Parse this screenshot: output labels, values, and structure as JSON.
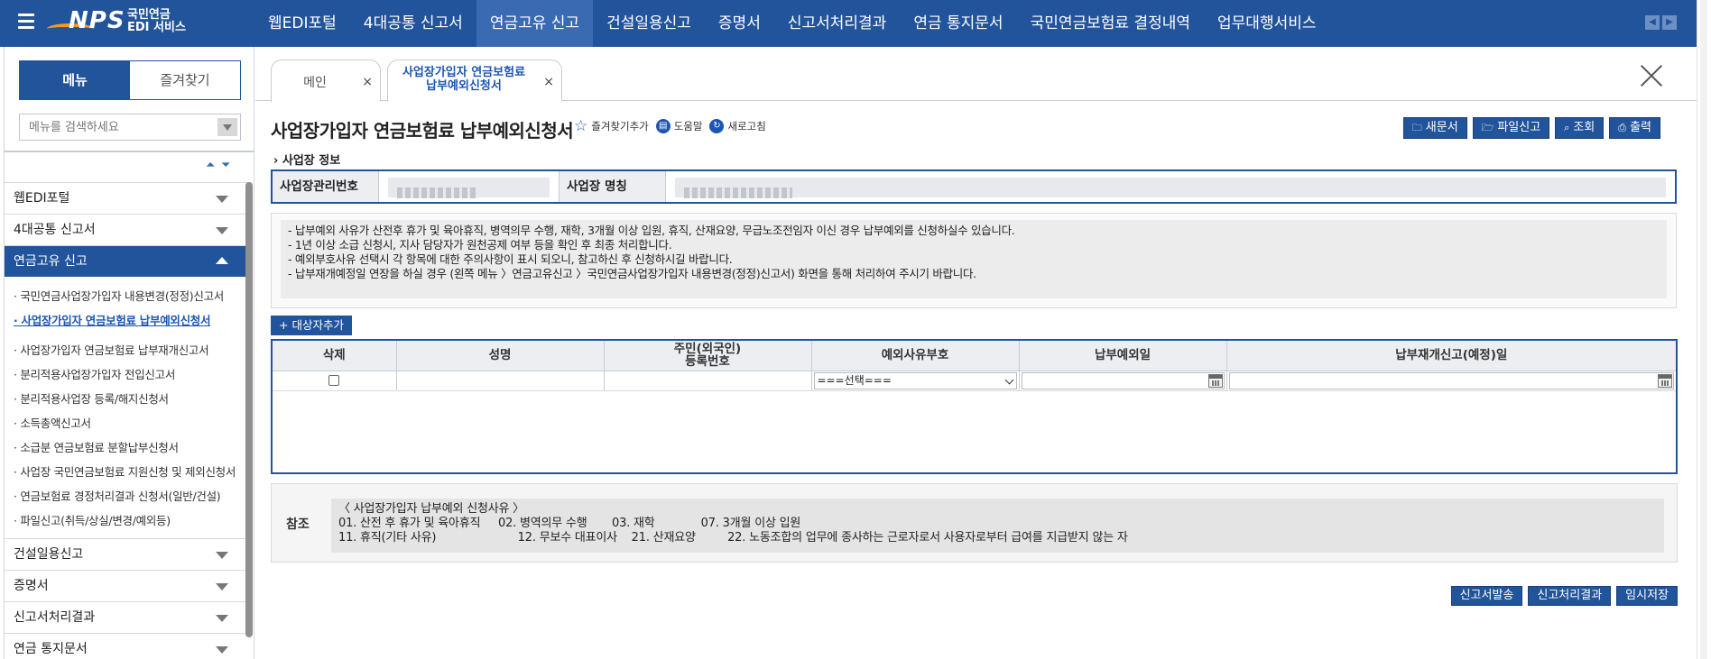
{
  "topbar": {
    "logo_main": "NPS",
    "logo_sub_1": "국민연금",
    "logo_sub_2": "EDI 서비스",
    "nav": [
      "웹EDI포털",
      "4대공통 신고서",
      "연금고유 신고",
      "건설일용신고",
      "증명서",
      "신고서처리결과",
      "연금 통지문서",
      "국민연금보험료 결정내역",
      "업무대행서비스"
    ],
    "active_nav_index": 2,
    "prev_icon": "chevron-left-icon",
    "next_icon": "chevron-right-icon",
    "accent_color": "#22549c"
  },
  "sidebar": {
    "tab_menu": "메뉴",
    "tab_favorites": "즐겨찾기",
    "search_placeholder": "메뉴를 검색하세요",
    "groups": {
      "g1": "웹EDI포털",
      "g2": "4대공통 신고서",
      "g3": "연금고유 신고",
      "g4": "건설일용신고",
      "g5": "증명서",
      "g6": "신고서처리결과",
      "g7": "연금 통지문서"
    },
    "sub_items": [
      "· 국민연금사업장가입자 내용변경(정정)신고서",
      "· 사업장가입자 연금보험료 납부예외신청서",
      "· 사업장가입자 연금보험료 납부재개신고서",
      "· 분리적용사업장가입자 전입신고서",
      "· 분리적용사업장 등록/해지신청서",
      "· 소득총액신고서",
      "· 소급분 연금보험료 분할납부신청서",
      "· 사업장 국민연금보험료 지원신청 및 제외신청서",
      "· 연금보험료 경정처리결과 신청서(일반/건설)",
      "· 파일신고(취득/상실/변경/예외등)"
    ],
    "selected_sub_index": 1
  },
  "tabs": {
    "main": "메인",
    "active_line1": "사업장가입자 연금보험료",
    "active_line2": "납부예외신청서",
    "close_symbol": "×"
  },
  "page": {
    "title": "사업장가입자 연금보험료 납부예외신청서",
    "tool_favorite": "즐겨찾기추가",
    "tool_help": "도움말",
    "tool_refresh": "새로고침",
    "btn_new": "새문서",
    "btn_file": "파일신고",
    "btn_search": "조회",
    "btn_print": "출력",
    "section_workplace": "› 사업장 정보",
    "label_mgmt_no": "사업장관리번호",
    "label_name": "사업장 명칭"
  },
  "notice": [
    "- 납부예외 사유가 산전후 휴가 및 육아휴직, 병역의무 수행, 재학, 3개월 이상 입원, 휴직, 산재요양, 무급노조전임자 이신 경우 납부예외를 신청하실수 있습니다.",
    "- 1년 이상 소급 신청시, 지사 담당자가 원천공제 여부 등을 확인 후 최종 처리합니다.",
    "- 예외부호사유 선택시 각 항목에 대한 주의사항이 표시 되오니, 참고하신 후 신청하시길 바랍니다.",
    "- 납부재개예정일 연장을 하실 경우 (왼쪽 메뉴 〉연금고유신고 〉국민연금사업장가입자 내용변경(정정)신고서) 화면을 통해 처리하여 주시기 바랍니다."
  ],
  "grid": {
    "add_button": "+ 대상자추가",
    "headers": {
      "delete": "삭제",
      "name": "성명",
      "rrn_line1": "주민(외국인)",
      "rrn_line2": "등록번호",
      "code": "예외사유부호",
      "exempt_date": "납부예외일",
      "resume_date": "납부재개신고(예정)일"
    },
    "select_value": "===선택==="
  },
  "reference": {
    "label": "참조",
    "line1": "〈 사업장가입자 납부예외 신청사유 〉",
    "line2": "01. 산전 후 휴가 및 육아휴직     02. 병역의무 수행       03. 재학             07. 3개월 이상 입원",
    "line3": "11. 휴직(기타 사유)                       12. 무보수 대표이사    21. 산재요양         22. 노동조합의 업무에 종사하는 근로자로서 사용자로부터 급여를 지급받지 않는 자"
  },
  "bottom": {
    "btn_send": "신고서발송",
    "btn_result": "신고처리결과",
    "btn_temp_save": "임시저장"
  }
}
